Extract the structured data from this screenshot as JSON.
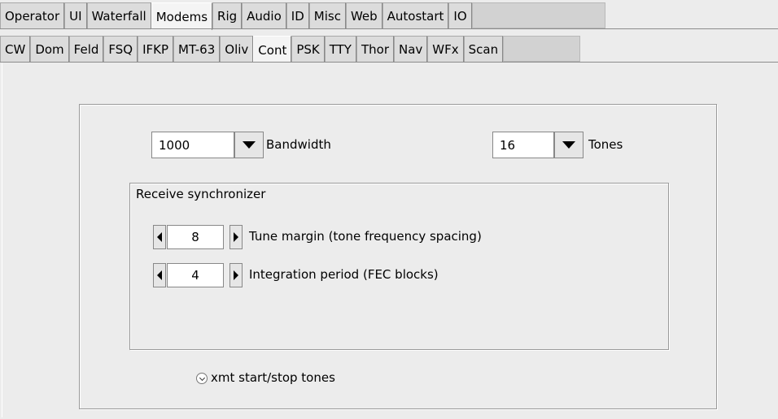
{
  "tabs_row1": [
    "Operator",
    "UI",
    "Waterfall",
    "Modems",
    "Rig",
    "Audio",
    "ID",
    "Misc",
    "Web",
    "Autostart",
    "IO"
  ],
  "tabs_row1_active": "Modems",
  "tabs_row2": [
    "CW",
    "Dom",
    "Feld",
    "FSQ",
    "IFKP",
    "MT-63",
    "Oliv",
    "Cont",
    "PSK",
    "TTY",
    "Thor",
    "Nav",
    "WFx",
    "Scan"
  ],
  "tabs_row2_active": "Cont",
  "bandwidth": {
    "value": "1000",
    "label": "Bandwidth"
  },
  "tones": {
    "value": "16",
    "label": "Tones"
  },
  "receive_sync": {
    "title": "Receive synchronizer",
    "tune_margin": {
      "value": "8",
      "label": "Tune margin (tone frequency spacing)"
    },
    "integration_period": {
      "value": "4",
      "label": "Integration period (FEC blocks)"
    }
  },
  "xmt_tones": {
    "label": "xmt start/stop tones",
    "checked": true
  }
}
